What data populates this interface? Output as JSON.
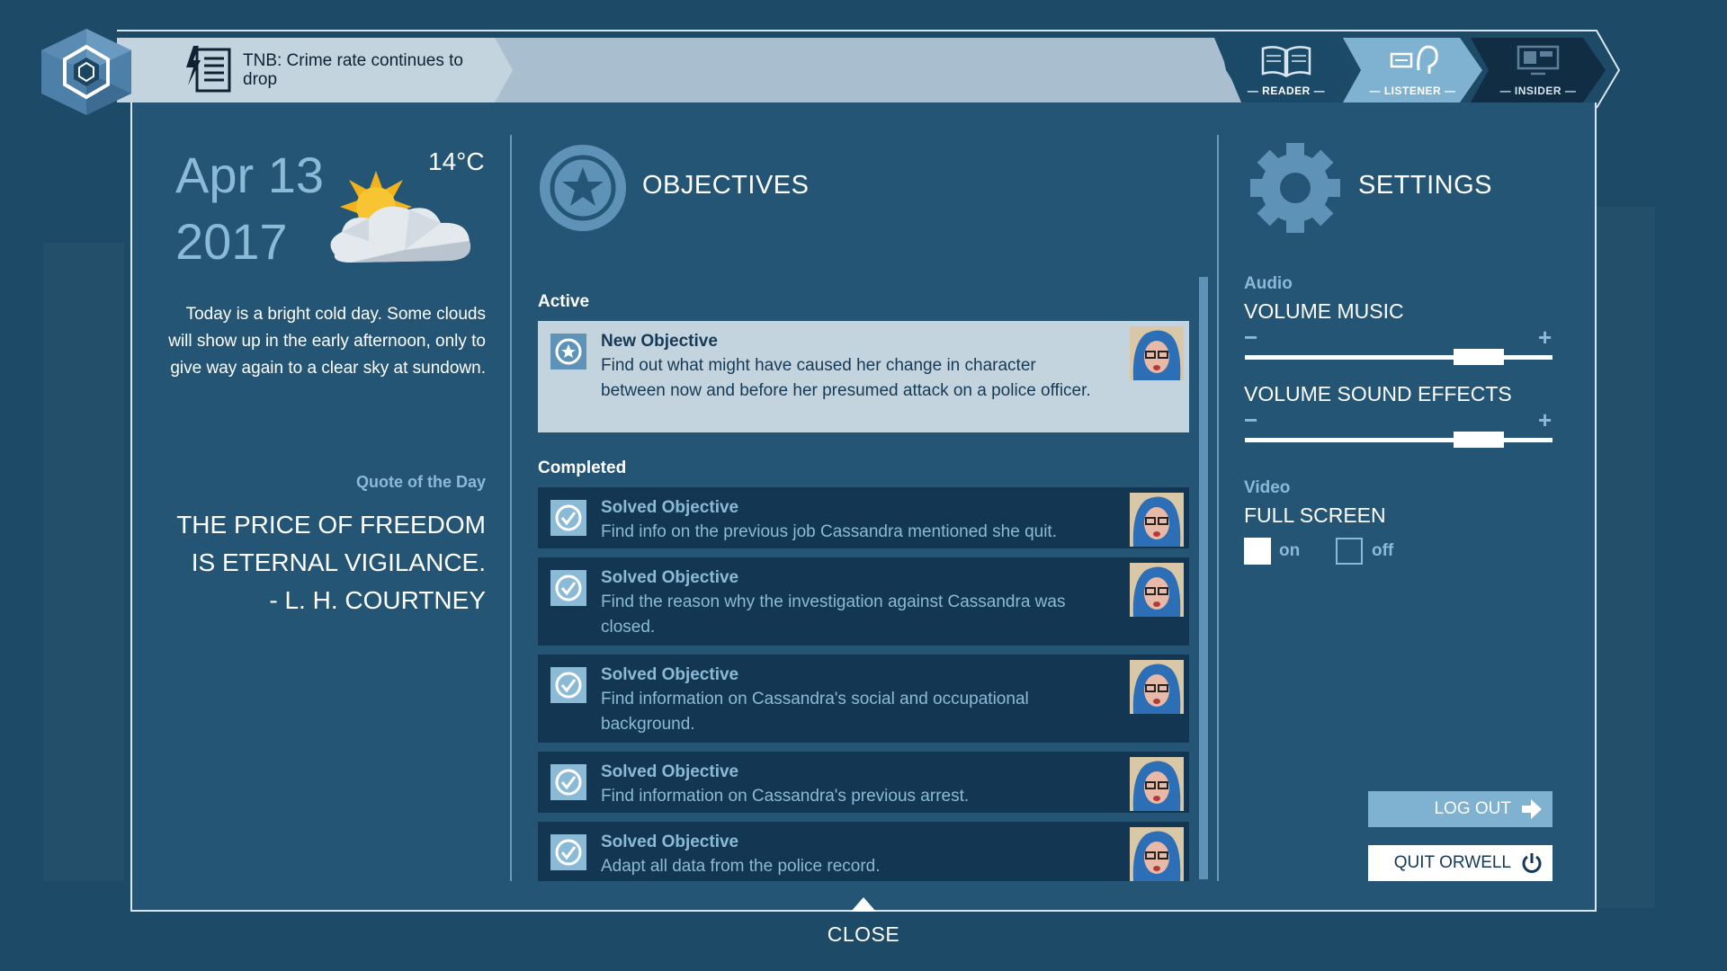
{
  "news": {
    "headline": "TNB: Crime rate continues to drop"
  },
  "modes": [
    {
      "label": "— READER —"
    },
    {
      "label": "— LISTENER —"
    },
    {
      "label": "— INSIDER —"
    }
  ],
  "info": {
    "date_line1": "Apr 13",
    "date_line2": "2017",
    "temperature": "14°C",
    "weather_description": "Today is a bright cold day. Some clouds will show up in the early afternoon, only to give way again to a clear sky at sundown.",
    "quote_heading": "Quote of the Day",
    "quote_line1": "THE PRICE OF FREEDOM",
    "quote_line2": "IS ETERNAL VIGILANCE.",
    "quote_line3": "- L. H. COURTNEY"
  },
  "objectives": {
    "title": "OBJECTIVES",
    "active_label": "Active",
    "completed_label": "Completed",
    "active": [
      {
        "head": "New Objective",
        "body": "Find out what might have caused her change in character between now and before her presumed attack on a police officer."
      }
    ],
    "completed": [
      {
        "head": "Solved Objective",
        "body": "Find info on the previous job Cassandra mentioned she quit."
      },
      {
        "head": "Solved Objective",
        "body": "Find the reason why the investigation against Cassandra was closed."
      },
      {
        "head": "Solved Objective",
        "body": "Find information on Cassandra's social and occupational background."
      },
      {
        "head": "Solved Objective",
        "body": "Find information on Cassandra's previous arrest."
      },
      {
        "head": "Solved Objective",
        "body": "Adapt all data from the police record."
      }
    ]
  },
  "settings": {
    "title": "SETTINGS",
    "audio_label": "Audio",
    "volume_music_label": "VOLUME MUSIC",
    "volume_music_level": 0.81,
    "volume_effects_label": "VOLUME SOUND EFFECTS",
    "volume_effects_level": 0.81,
    "minus": "−",
    "plus": "+",
    "video_label": "Video",
    "fullscreen_label": "FULL SCREEN",
    "on_label": "on",
    "off_label": "off",
    "fullscreen_on": true,
    "logout_label": "LOG OUT",
    "quit_label": "QUIT ORWELL"
  },
  "close_label": "CLOSE",
  "colors": {
    "accent": "#8bbad6",
    "listener_active": "#7fb1d0",
    "panel": "#255676",
    "card_dark": "#133752",
    "card_light": "#c4d4df"
  },
  "icons": {
    "logo": "hex-eye-logo",
    "news": "newspaper-lightning-icon",
    "reader": "open-book-icon",
    "listener": "ear-icon",
    "insider": "monitor-icon",
    "objectives": "star-badge-icon",
    "settings": "gear-icon",
    "objective": "target-icon",
    "logout": "arrow-right-icon",
    "quit": "power-icon"
  }
}
